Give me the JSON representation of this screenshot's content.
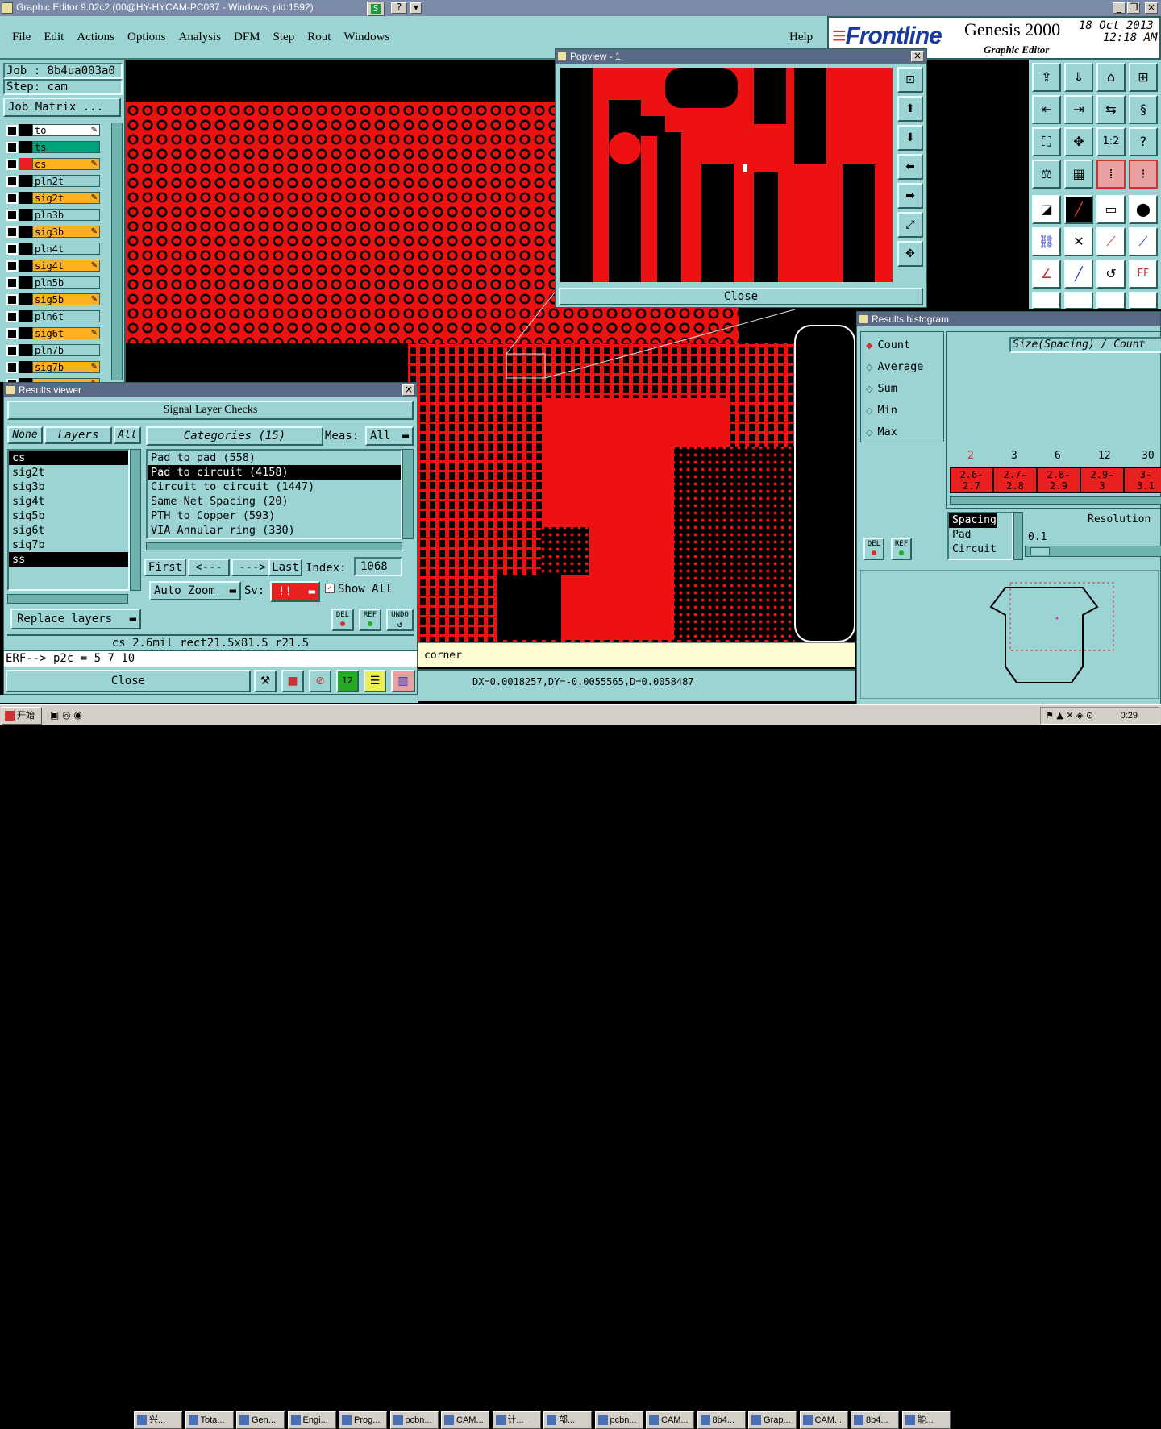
{
  "titlebar": {
    "title": "Graphic Editor 9.02c2 (00@HY-HYCAM-PC037 - Windows, pid:1592)"
  },
  "menu": [
    "File",
    "Edit",
    "Actions",
    "Options",
    "Analysis",
    "DFM",
    "Step",
    "Rout",
    "Windows"
  ],
  "help": "Help",
  "brand": {
    "logo": "Frontline",
    "product": "Genesis 2000",
    "subtitle": "Graphic Editor",
    "date": "18 Oct 2013",
    "time": "12:18 AM"
  },
  "job": {
    "job": "Job : 8b4ua003a0",
    "step": "Step: cam",
    "matrix": "Job Matrix ..."
  },
  "layers": [
    {
      "name": "to",
      "color": "#ffffff"
    },
    {
      "name": "ts",
      "color": "#00a37a"
    },
    {
      "name": "cs",
      "color": "#ffb020"
    },
    {
      "name": "pln2t",
      "color": "#9cd4d4"
    },
    {
      "name": "sig2t",
      "color": "#ffb020"
    },
    {
      "name": "pln3b",
      "color": "#9cd4d4"
    },
    {
      "name": "sig3b",
      "color": "#ffb020"
    },
    {
      "name": "pln4t",
      "color": "#9cd4d4"
    },
    {
      "name": "sig4t",
      "color": "#ffb020"
    },
    {
      "name": "pln5b",
      "color": "#9cd4d4"
    },
    {
      "name": "sig5b",
      "color": "#ffb020"
    },
    {
      "name": "pln6t",
      "color": "#9cd4d4"
    },
    {
      "name": "sig6t",
      "color": "#ffb020"
    },
    {
      "name": "pln7b",
      "color": "#9cd4d4"
    },
    {
      "name": "sig7b",
      "color": "#ffb020"
    },
    {
      "name": "ss",
      "color": "#ffb020"
    }
  ],
  "popview": {
    "title": "Popview - 1",
    "close": "Close"
  },
  "results_viewer": {
    "title": "Results viewer",
    "header": "Signal Layer Checks",
    "none": "None",
    "layers_label": "Layers",
    "all": "All",
    "categories_label": "Categories (15)",
    "meas_label": "Meas:",
    "meas_value": "All",
    "layer_list": [
      "cs",
      "sig2t",
      "sig3b",
      "sig4t",
      "sig5b",
      "sig6t",
      "sig7b",
      "ss"
    ],
    "categories": [
      "Pad to pad (558)",
      "Pad to circuit (4158)",
      "Circuit to circuit (1447)",
      "Same Net Spacing (20)",
      "PTH to Copper (593)",
      "VIA Annular ring (330)"
    ],
    "nav": {
      "first": "First",
      "prev": "<---",
      "next": "--->",
      "last": "Last",
      "index_label": "Index:",
      "index_value": "1068"
    },
    "auto_zoom": "Auto Zoom",
    "sv_label": "Sv:",
    "sv_value": "!!",
    "show_all": "Show All",
    "del": "DEL",
    "ref": "REF",
    "undo": "UNDO",
    "replace": "Replace layers",
    "status": "cs  2.6mil   rect21.5x81.5   r21.5",
    "erf": "ERF--> p2c = 5 7 10",
    "close": "Close"
  },
  "canvas": {
    "corner": "corner",
    "coords": "DX=0.0018257,DY=-0.0055565,D=0.0058487"
  },
  "histogram": {
    "title": "Results histogram",
    "modes": [
      "Count",
      "Average",
      "Sum",
      "Min",
      "Max"
    ],
    "axis_title": "Size(Spacing) / Count",
    "counts": [
      "2",
      "3",
      "6",
      "12",
      "30"
    ],
    "bins": [
      "2.6-\n2.7",
      "2.7-\n2.8",
      "2.8-\n2.9",
      "2.9-\n3",
      "3-\n3.1"
    ],
    "types": [
      "Spacing",
      "Pad",
      "Circuit"
    ],
    "resolution_label": "Resolution",
    "resolution_value": "0.1",
    "del": "DEL",
    "ref": "REF"
  },
  "taskbar": {
    "start": "开始",
    "clock": "0:29",
    "items": [
      "兴...",
      "Tota...",
      "Gen...",
      "Engi...",
      "Prog...",
      "pcbn...",
      "CAM...",
      "计...",
      "部...",
      "pcbn...",
      "CAM...",
      "8b4...",
      "Grap...",
      "CAM...",
      "8b4...",
      "能..."
    ]
  }
}
